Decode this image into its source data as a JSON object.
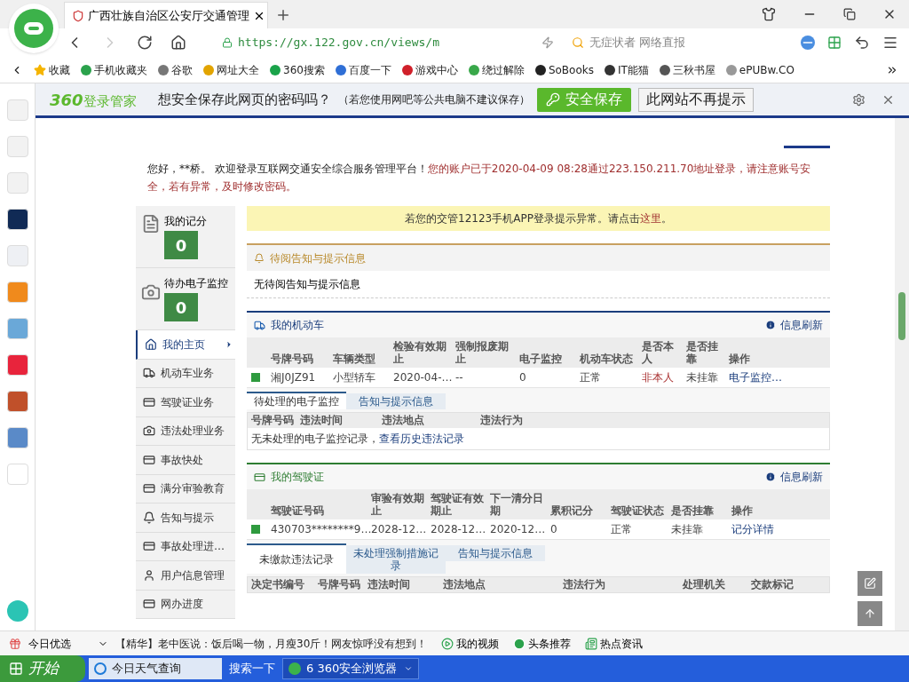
{
  "browser": {
    "tab_title": "广西壮族自治区公安厅交通管理",
    "url": "https://gx.122.gov.cn/views/m",
    "search_placeholder": "无症状者 网络直报",
    "bookmarks": [
      {
        "label": "收藏"
      },
      {
        "label": "手机收藏夹"
      },
      {
        "label": "谷歌"
      },
      {
        "label": "网址大全"
      },
      {
        "label": "360搜索"
      },
      {
        "label": "百度一下"
      },
      {
        "label": "游戏中心"
      },
      {
        "label": "绕过解除"
      },
      {
        "label": "SoBooks"
      },
      {
        "label": "IT能猫"
      },
      {
        "label": "三秋书屋"
      },
      {
        "label": "ePUBw.CO"
      }
    ]
  },
  "password_bar": {
    "brand_number": "360",
    "brand_name": "登录管家",
    "question": "想安全保存此网页的密码吗？",
    "note": "（若您使用网吧等公共电脑不建议保存）",
    "save_button": "安全保存",
    "dismiss_button": "此网站不再提示"
  },
  "page": {
    "greeting": "您好，**桥。 欢迎登录互联网交通安全综合服务管理平台！",
    "security_warning": "您的账户已于2020-04-09 08:28通过223.150.211.70地址登录，请注意账号安全，若有异常，及时修改密码。",
    "stats": [
      {
        "label": "我的记分",
        "value": "0",
        "kind": "points"
      },
      {
        "label": "待办电子监控",
        "value": "0",
        "kind": "camera"
      }
    ],
    "nav": [
      {
        "label": "我的主页",
        "kind": "home",
        "selected": true
      },
      {
        "label": "机动车业务",
        "kind": "truck",
        "selected": false
      },
      {
        "label": "驾驶证业务",
        "kind": "card",
        "selected": false
      },
      {
        "label": "违法处理业务",
        "kind": "camera",
        "selected": false
      },
      {
        "label": "事故快处",
        "kind": "card",
        "selected": false
      },
      {
        "label": "满分审验教育",
        "kind": "card",
        "selected": false
      },
      {
        "label": "告知与提示",
        "kind": "bell",
        "selected": false
      },
      {
        "label": "事故处理进…",
        "kind": "card",
        "selected": false
      },
      {
        "label": "用户信息管理",
        "kind": "user",
        "selected": false
      },
      {
        "label": "网办进度",
        "kind": "card",
        "selected": false
      }
    ],
    "banner": {
      "text": "若您的交管12123手机APP登录提示异常。请点击",
      "link": "这里",
      "end": "。"
    },
    "pending": {
      "title": "待阅告知与提示信息",
      "body": "无待阅告知与提示信息"
    },
    "vehicles": {
      "title": "我的机动车",
      "refresh": "信息刷新",
      "columns": [
        "号牌号码",
        "车辆类型",
        "检验有效期止",
        "强制报废期止",
        "电子监控",
        "机动车状态",
        "是否本人",
        "是否挂靠",
        "操作"
      ],
      "rows": [
        {
          "color": "#2e9a3e",
          "cells": [
            "湘J0JZ91",
            "小型轿车",
            "2020-04-…",
            "--",
            "0",
            "正常",
            "非本人",
            "未挂靠",
            "电子监控…"
          ]
        }
      ],
      "tabs": [
        {
          "label": "待处理的电子监控",
          "selected": true
        },
        {
          "label": "告知与提示信息",
          "selected": false
        }
      ],
      "sub_columns": [
        "号牌号码",
        "违法时间",
        "违法地点",
        "违法行为"
      ],
      "empty_text": "无未处理的电子监控记录，",
      "empty_link": "查看历史违法记录"
    },
    "license": {
      "title": "我的驾驶证",
      "refresh": "信息刷新",
      "columns": [
        "驾驶证号码",
        "审验有效期止",
        "驾驶证有效期止",
        "下一清分日期",
        "累积记分",
        "驾驶证状态",
        "是否挂靠",
        "操作"
      ],
      "rows": [
        {
          "color": "#2e9a3e",
          "cells": [
            "430703********9…",
            "2028-12…",
            "2028-12…",
            "2020-12…",
            "0",
            "正常",
            "未挂靠",
            "记分详情"
          ]
        }
      ],
      "tabs": [
        {
          "label": "未缴款违法记录",
          "selected": true
        },
        {
          "label": "未处理强制措施记录",
          "selected": false
        },
        {
          "label": "告知与提示信息",
          "selected": false
        }
      ],
      "sub_columns": [
        "决定书编号",
        "号牌号码",
        "违法时间",
        "违法地点",
        "违法行为",
        "处理机关",
        "交款标记"
      ]
    }
  },
  "news_bar": {
    "label": "今日优选",
    "headline": "【精华】老中医说：饭后喝一物，月瘦30斤！网友惊呼没有想到！",
    "items": [
      "我的视频",
      "头条推荐",
      "热点资讯"
    ]
  },
  "taskbar": {
    "start": "开始",
    "items": [
      {
        "label": "今日天气查询",
        "kind": "ie"
      },
      {
        "label": "搜索一下",
        "kind": "plain"
      },
      {
        "label": "6 360安全浏览器",
        "kind": "browser"
      }
    ]
  }
}
